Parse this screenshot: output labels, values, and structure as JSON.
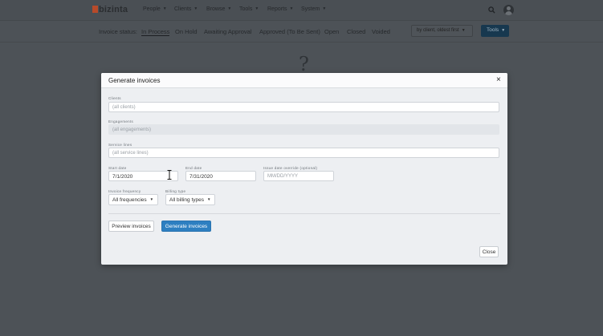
{
  "app": {
    "logo_text": "bizinta",
    "nav": [
      {
        "label": "People"
      },
      {
        "label": "Clients"
      },
      {
        "label": "Browse"
      },
      {
        "label": "Tools"
      },
      {
        "label": "Reports"
      },
      {
        "label": "System"
      }
    ],
    "icons": {
      "search": "search-icon",
      "user": "user-avatar-icon"
    }
  },
  "subbar": {
    "status_label": "Invoice status:",
    "tabs": [
      {
        "label": "In Process",
        "active": true
      },
      {
        "label": "On Hold"
      },
      {
        "label": "Awaiting Approval"
      },
      {
        "label": "Approved (To Be Sent)"
      },
      {
        "label": "Open"
      },
      {
        "label": "Closed"
      },
      {
        "label": "Voided"
      }
    ],
    "sort_value": "by client, oldest first",
    "tools_label": "Tools",
    "placeholder_glyph": "?"
  },
  "modal": {
    "title": "Generate invoices",
    "close_glyph": "×",
    "clients": {
      "label": "Clients",
      "placeholder": "(all clients)"
    },
    "engagements": {
      "label": "Engagements",
      "placeholder": "(all engagements)"
    },
    "service_lines": {
      "label": "Service lines",
      "placeholder": "(all service lines)"
    },
    "start_date": {
      "label": "Start date",
      "value": "7/1/2020"
    },
    "end_date": {
      "label": "End date",
      "value": "7/31/2020"
    },
    "issue_date": {
      "label": "Issue date override (optional)",
      "placeholder": "MM/DD/YYYY"
    },
    "invoice_frequency": {
      "label": "Invoice frequency",
      "value": "All frequencies"
    },
    "billing_type": {
      "label": "Billing type",
      "value": "All billing types"
    },
    "preview_button": "Preview invoices",
    "generate_button": "Generate invoices",
    "close_button": "Close"
  },
  "colors": {
    "primary": "#2d7fc1",
    "overlay": "#4d5257",
    "tools_button": "#17384f"
  }
}
